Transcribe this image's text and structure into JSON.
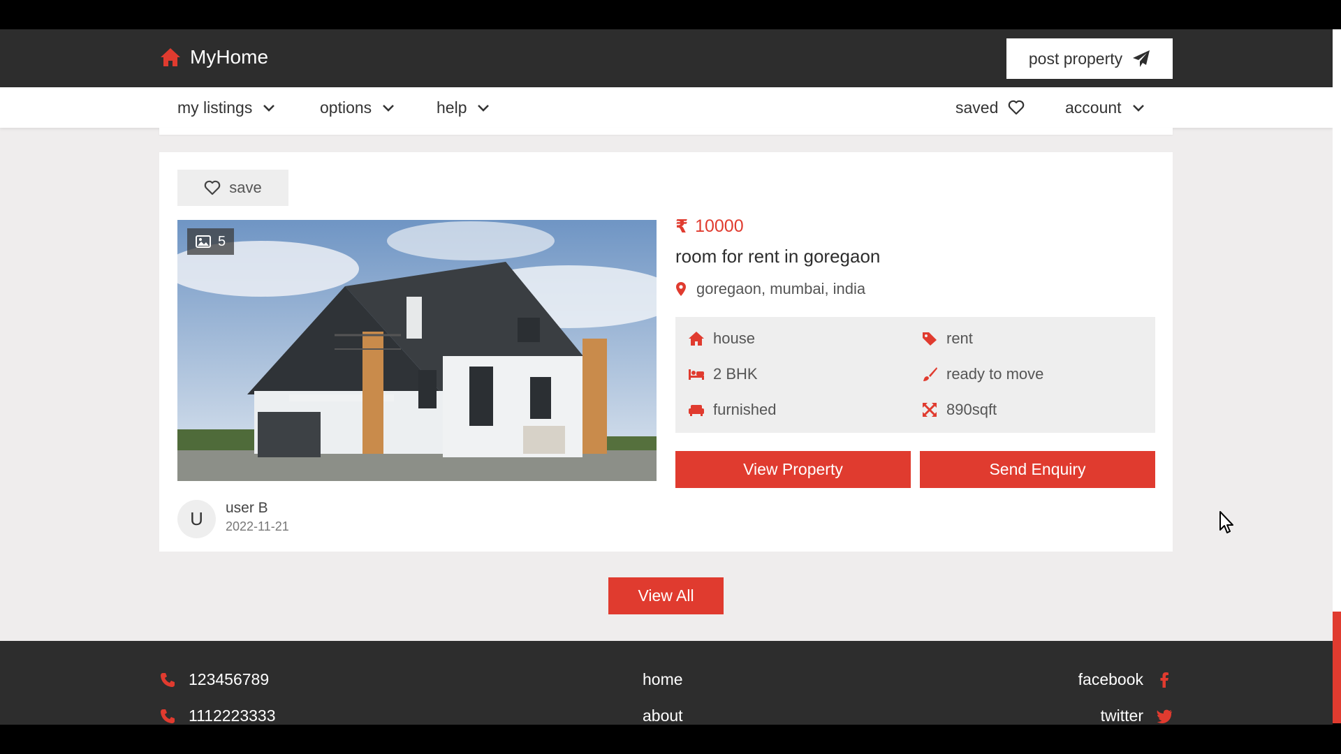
{
  "header": {
    "logo_text": "MyHome",
    "post_property_label": "post property"
  },
  "nav": {
    "my_listings": "my listings",
    "options": "options",
    "help": "help",
    "saved": "saved",
    "account": "account"
  },
  "listing": {
    "save_label": "save",
    "photo_count": "5",
    "currency_symbol": "₹",
    "price": "10000",
    "title": "room for rent in goregaon",
    "location": "goregaon, mumbai, india",
    "features": {
      "type": "house",
      "purpose": "rent",
      "bhk": "2 BHK",
      "status": "ready to move",
      "furnishing": "furnished",
      "area": "890sqft"
    },
    "view_property_label": "View Property",
    "send_enquiry_label": "Send Enquiry",
    "user_initial": "U",
    "user_name": "user B",
    "posted_date": "2022-11-21"
  },
  "view_all_label": "View All",
  "footer": {
    "phone1": "123456789",
    "phone2": "1112223333",
    "link_home": "home",
    "link_about": "about",
    "social_facebook": "facebook",
    "social_twitter": "twitter"
  },
  "dev_button_label": "</>",
  "colors": {
    "accent": "#e03b2f",
    "header_bg": "#2d2d2d",
    "page_bg": "#efeded"
  }
}
